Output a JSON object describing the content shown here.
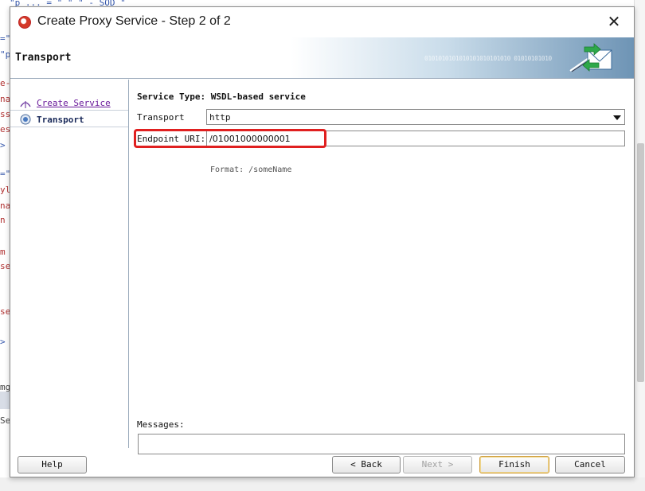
{
  "dialog": {
    "title": "Create Proxy Service - Step 2 of 2",
    "close_symbol": "✕",
    "app_icon": "oracle-app-icon",
    "header_title": "Transport",
    "header_binary": "0101010101010101010101010 01010101010",
    "header_icon": "proxy-service-envelope-icon"
  },
  "nav": {
    "steps": [
      {
        "label": "Create Service",
        "state": "completed"
      },
      {
        "label": "Transport",
        "state": "current"
      }
    ]
  },
  "form": {
    "service_type": "Service Type: WSDL-based service",
    "transport_label": "Transport",
    "transport_value": "http",
    "endpoint_label": "Endpoint URI:",
    "endpoint_value": "/01001000000001",
    "format_hint": "Format:  /someName",
    "messages_label": "Messages:"
  },
  "buttons": {
    "help": "Help",
    "back": "< Back",
    "next": "Next >",
    "finish": "Finish",
    "cancel": "Cancel"
  },
  "colors": {
    "highlight": "#e02020",
    "header_gradient_end": "#6e94b5",
    "visited_link": "#6a1a9a"
  }
}
